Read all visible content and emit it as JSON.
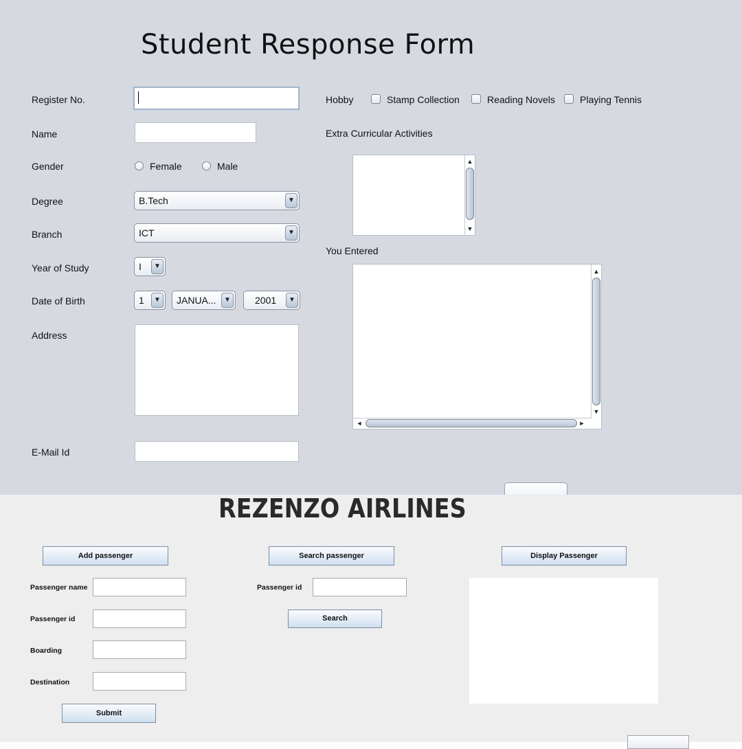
{
  "student_form": {
    "title": "Student Response Form",
    "labels": {
      "register_no": "Register No.",
      "name": "Name",
      "gender": "Gender",
      "degree": "Degree",
      "branch": "Branch",
      "year_of_study": "Year of Study",
      "date_of_birth": "Date of Birth",
      "address": "Address",
      "email": "E-Mail Id",
      "hobby": "Hobby",
      "extra_curricular": "Extra Curricular Activities",
      "you_entered": "You Entered"
    },
    "register_no_value": "",
    "name_value": "",
    "email_value": "",
    "gender_options": [
      "Female",
      "Male"
    ],
    "degree_selected": "B.Tech",
    "branch_selected": "ICT",
    "year_selected": "I",
    "dob": {
      "day": "1",
      "month": "JANUA...",
      "year": "2001"
    },
    "hobbies": [
      "Stamp Collection",
      "Reading Novels",
      "Playing Tennis"
    ],
    "icons": {
      "up": "▲",
      "down": "▼",
      "left": "◄",
      "right": "►"
    }
  },
  "airline_form": {
    "title": "REZENZO AIRLINES",
    "buttons": {
      "add": "Add passenger",
      "search_tab": "Search passenger",
      "display": "Display Passenger",
      "search": "Search",
      "submit": "Submit"
    },
    "labels": {
      "passenger_name": "Passenger name",
      "passenger_id": "Passenger id",
      "boarding": "Boarding",
      "destination": "Destination",
      "search_passenger_id": "Passenger id"
    }
  }
}
